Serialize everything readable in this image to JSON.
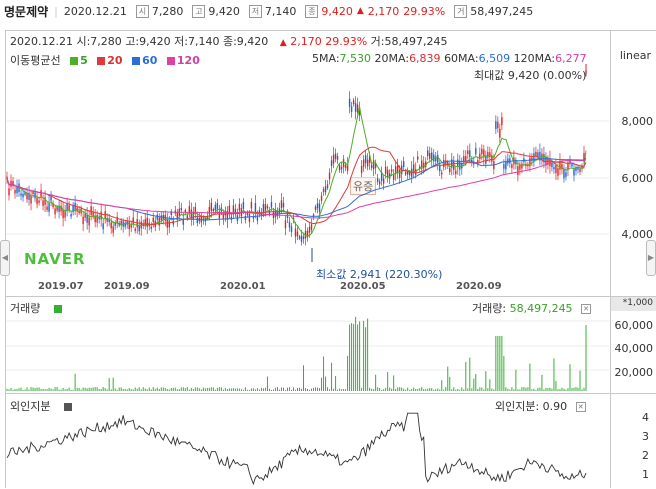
{
  "header": {
    "name": "명문제약",
    "date": "2020.12.21",
    "open_icon": "시",
    "open": "7,280",
    "high_icon": "고",
    "high": "9,420",
    "low_icon": "저",
    "low": "7,140",
    "close_icon": "종",
    "close": "9,420",
    "change": "2,170",
    "change_pct": "29.93%",
    "volume_icon": "거",
    "volume": "58,497,245"
  },
  "info_line": {
    "date": "2020.12.21",
    "open": "시:7,280",
    "high": "고:9,420",
    "low": "저:7,140",
    "close": "종:9,420",
    "change": "2,170",
    "change_pct": "29.93%",
    "volume": "거:58,497,245"
  },
  "price_panel": {
    "ma_label": "이동평균선",
    "ma_legend": [
      {
        "label": "5",
        "color": "#4caf28"
      },
      {
        "label": "20",
        "color": "#e03a3a"
      },
      {
        "label": "60",
        "color": "#2b6fd4"
      },
      {
        "label": "120",
        "color": "#e040a0"
      }
    ],
    "ma_values": [
      {
        "label": "5MA:",
        "value": "7,530",
        "color": "#3aa02a"
      },
      {
        "label": "20MA:",
        "value": "6,839",
        "color": "#d83030"
      },
      {
        "label": "60MA:",
        "value": "6,509",
        "color": "#2b6fd4"
      },
      {
        "label": "120MA:",
        "value": "6,277",
        "color": "#d040a0"
      }
    ],
    "scale": "linear",
    "max_label": "최대값 9,420 (0.00%)",
    "min_label": "최소값 2,941 (220.30%)",
    "event_label": "유증",
    "logo": "NAVER",
    "y_ticks": [
      "8,000",
      "6,000",
      "4,000"
    ],
    "x_ticks": [
      "2019.07",
      "2019.09",
      "2020.01",
      "2020.05",
      "2020.09"
    ]
  },
  "volume_panel": {
    "title": "거래량",
    "readout_label": "거래량:",
    "readout_value": "58,497,245",
    "unit": "*1,000",
    "y_ticks": [
      "60,000",
      "40,000",
      "20,000"
    ]
  },
  "foreign_panel": {
    "title": "외인지분",
    "readout": "외인지분: 0.90",
    "y_ticks": [
      "4",
      "3",
      "2",
      "1"
    ]
  },
  "colors": {
    "up": "#e02020",
    "down": "#1f5fcf",
    "volume_bar": "#34b034",
    "logo": "#4dbf3a",
    "line": "#333333"
  },
  "icons": [
    "close-icon",
    "chevron-left-icon",
    "chevron-right-icon"
  ]
}
